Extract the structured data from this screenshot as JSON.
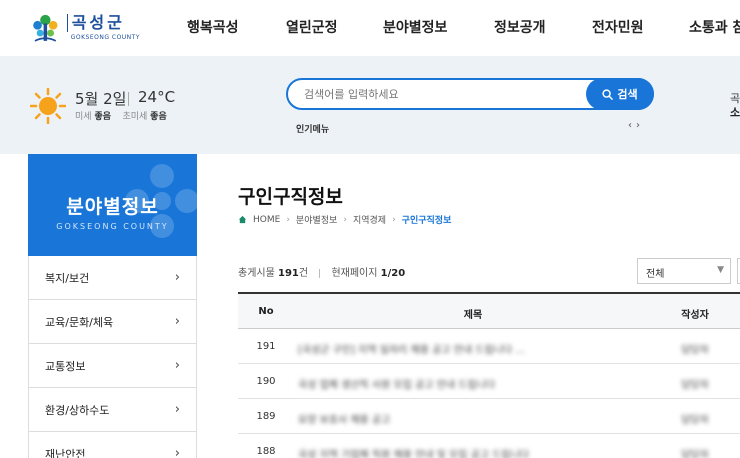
{
  "header": {
    "logo": {
      "ko": "곡성군",
      "en": "GOKSEONG COUNTY"
    },
    "nav": [
      "행복곡성",
      "열린군정",
      "분야별정보",
      "정보공개",
      "전자민원",
      "소통과 참"
    ]
  },
  "weather": {
    "date": "5월 2일",
    "temp": "24°C",
    "dust_label": "미세",
    "dust_value": "좋음",
    "ultra_label": "초미세",
    "ultra_value": "좋음",
    "icon": "sun-icon"
  },
  "search": {
    "placeholder": "검색어를 입력하세요",
    "button": "검색",
    "popular_label": "인기메뉴",
    "right_top": "곡",
    "right_bottom": "소"
  },
  "sidebar": {
    "title": "분야별정보",
    "subtitle": "GOKSEONG COUNTY",
    "items": [
      {
        "label": "복지/보건"
      },
      {
        "label": "교육/문화/체육"
      },
      {
        "label": "교통정보"
      },
      {
        "label": "환경/상하수도"
      },
      {
        "label": "재난안전"
      }
    ]
  },
  "content": {
    "title": "구인구직정보",
    "breadcrumb": [
      "HOME",
      "분야별정보",
      "지역경제",
      "구인구직정보"
    ],
    "total_label": "총게시물",
    "total_value": "191",
    "total_unit": "건",
    "page_label": "현재페이지",
    "page_value": "1/20",
    "filter_selected": "전체"
  },
  "table": {
    "headers": {
      "no": "No",
      "title": "제목",
      "writer": "작성자"
    },
    "rows": [
      {
        "no": "191",
        "title": "[곡성군 구인] 지역 일자리 채용 공고 안내 드립니다 ...",
        "writer": "담당자"
      },
      {
        "no": "190",
        "title": "곡성 업체 생산직 사원 모집 공고 안내 드립니다",
        "writer": "담당자"
      },
      {
        "no": "189",
        "title": "요양 보호사 채용 공고",
        "writer": "담당자"
      },
      {
        "no": "188",
        "title": "곡성 지역 기업체 직원 채용 안내 및 모집 공고 드립니다",
        "writer": "담당자"
      }
    ]
  },
  "colors": {
    "primary": "#1976d8",
    "band": "#edf2f6",
    "sun": "#f7a21b"
  }
}
